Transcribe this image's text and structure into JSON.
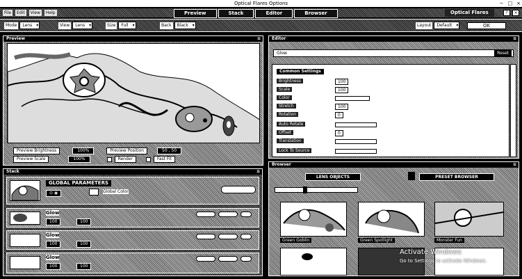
{
  "window": {
    "title": "Optical Flares Options",
    "controls": [
      "−",
      "□",
      "×"
    ]
  },
  "menubar": {
    "menus": [
      "File",
      "Edit",
      "View",
      "Help"
    ],
    "modes": [
      "Preview",
      "Stack",
      "Editor",
      "Browser"
    ],
    "brand": "Optical Flares"
  },
  "toolbar": {
    "groups": [
      {
        "label": "Mode",
        "value": "Lens"
      },
      {
        "label": "View",
        "value": "Lens"
      },
      {
        "label": "Size",
        "value": "Full"
      },
      {
        "label": "Back",
        "value": "Black"
      }
    ],
    "right_group": {
      "label": "Layout",
      "value": "Default"
    },
    "ok_label": "OK"
  },
  "preview": {
    "title": "Preview",
    "rows": [
      {
        "a_label": "Preview Brightness",
        "a_value": "100%",
        "b_label": "Preview Position",
        "b_value": "50 , 50"
      },
      {
        "a_label": "Preview Scale",
        "a_value": "100%",
        "b_label": "Render",
        "b_value": "Fast Fit"
      }
    ]
  },
  "editor": {
    "title": "Editor",
    "selected": "Glow",
    "reset_label": "Reset",
    "section": "Common Settings",
    "rows": [
      {
        "name": "Brightness",
        "value": "100"
      },
      {
        "name": "Scale",
        "value": "100"
      },
      {
        "name": "Color",
        "value": ""
      },
      {
        "name": "Stretch",
        "value": "100"
      },
      {
        "name": "Rotation",
        "value": "0"
      },
      {
        "name": "Auto Rotate",
        "value": ""
      },
      {
        "name": "Offset",
        "value": "0"
      },
      {
        "name": "Translation",
        "value": ""
      },
      {
        "name": "Lock To Source",
        "value": ""
      }
    ]
  },
  "stack": {
    "title": "Stack",
    "global": {
      "title": "GLOBAL PARAMETERS",
      "color_label": "Global Color"
    },
    "items": [
      {
        "name": "Glow",
        "v1": "100",
        "v2": "100"
      },
      {
        "name": "Glow",
        "v1": "100",
        "v2": "100"
      },
      {
        "name": "Glow",
        "v1": "100",
        "v2": "100"
      }
    ]
  },
  "browser": {
    "title": "Browser",
    "lens_objects_label": "LENS OBJECTS",
    "preset_browser_label": "PRESET BROWSER",
    "presets": [
      "Green Goblin",
      "Green Spotlight",
      "Monster Fun",
      "",
      "",
      ""
    ]
  },
  "watermark": {
    "line1": "Activate Windows",
    "line2": "Go to Settings to activate Windows."
  }
}
